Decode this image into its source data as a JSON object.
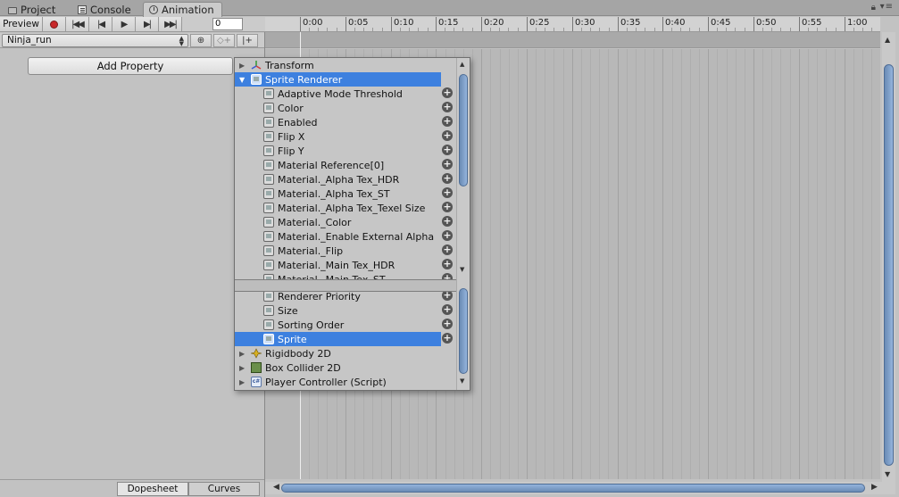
{
  "tabs": [
    {
      "label": "Project",
      "icon": "folder-icon"
    },
    {
      "label": "Console",
      "icon": "console-icon"
    },
    {
      "label": "Animation",
      "icon": "clock-icon"
    }
  ],
  "toolbar": {
    "preview_label": "Preview",
    "frame_value": "0"
  },
  "clip": {
    "selected": "Ninja_run"
  },
  "left_panel": {
    "add_property_label": "Add Property"
  },
  "bottom_tabs": {
    "dopesheet": "Dopesheet",
    "curves": "Curves"
  },
  "ruler": {
    "labels": [
      "0:00",
      "0:05",
      "0:10",
      "0:15",
      "0:20",
      "0:25",
      "0:30",
      "0:35",
      "0:40",
      "0:45",
      "0:50",
      "0:55",
      "1:00"
    ]
  },
  "popup": {
    "top_rows": [
      {
        "label": "Transform",
        "type": "component",
        "icon": "transform-icon",
        "expanded": false
      },
      {
        "label": "Sprite Renderer",
        "type": "component",
        "icon": "sprite-renderer-icon",
        "expanded": true,
        "selected": true
      },
      {
        "label": "Adaptive Mode Threshold",
        "type": "property"
      },
      {
        "label": "Color",
        "type": "property"
      },
      {
        "label": "Enabled",
        "type": "property"
      },
      {
        "label": "Flip X",
        "type": "property"
      },
      {
        "label": "Flip Y",
        "type": "property"
      },
      {
        "label": "Material Reference[0]",
        "type": "property"
      },
      {
        "label": "Material._Alpha Tex_HDR",
        "type": "property"
      },
      {
        "label": "Material._Alpha Tex_ST",
        "type": "property"
      },
      {
        "label": "Material._Alpha Tex_Texel Size",
        "type": "property"
      },
      {
        "label": "Material._Color",
        "type": "property"
      },
      {
        "label": "Material._Enable External Alpha",
        "type": "property"
      },
      {
        "label": "Material._Flip",
        "type": "property"
      },
      {
        "label": "Material._Main Tex_HDR",
        "type": "property"
      },
      {
        "label": "Material._Main Tex_ST",
        "type": "property"
      }
    ],
    "bottom_rows": [
      {
        "label": "Renderer Priority",
        "type": "property"
      },
      {
        "label": "Size",
        "type": "property"
      },
      {
        "label": "Sorting Order",
        "type": "property"
      },
      {
        "label": "Sprite",
        "type": "property",
        "selected": true
      },
      {
        "label": "Rigidbody 2D",
        "type": "component",
        "icon": "rigidbody2d-icon"
      },
      {
        "label": "Box Collider 2D",
        "type": "component",
        "icon": "box-collider-icon"
      },
      {
        "label": "Player Controller (Script)",
        "type": "component",
        "icon": "script-icon",
        "icon_text": "c#"
      }
    ]
  },
  "colors": {
    "selection": "#3d80df",
    "record": "#c8282a",
    "scroll_thumb": "#7f9fca"
  }
}
